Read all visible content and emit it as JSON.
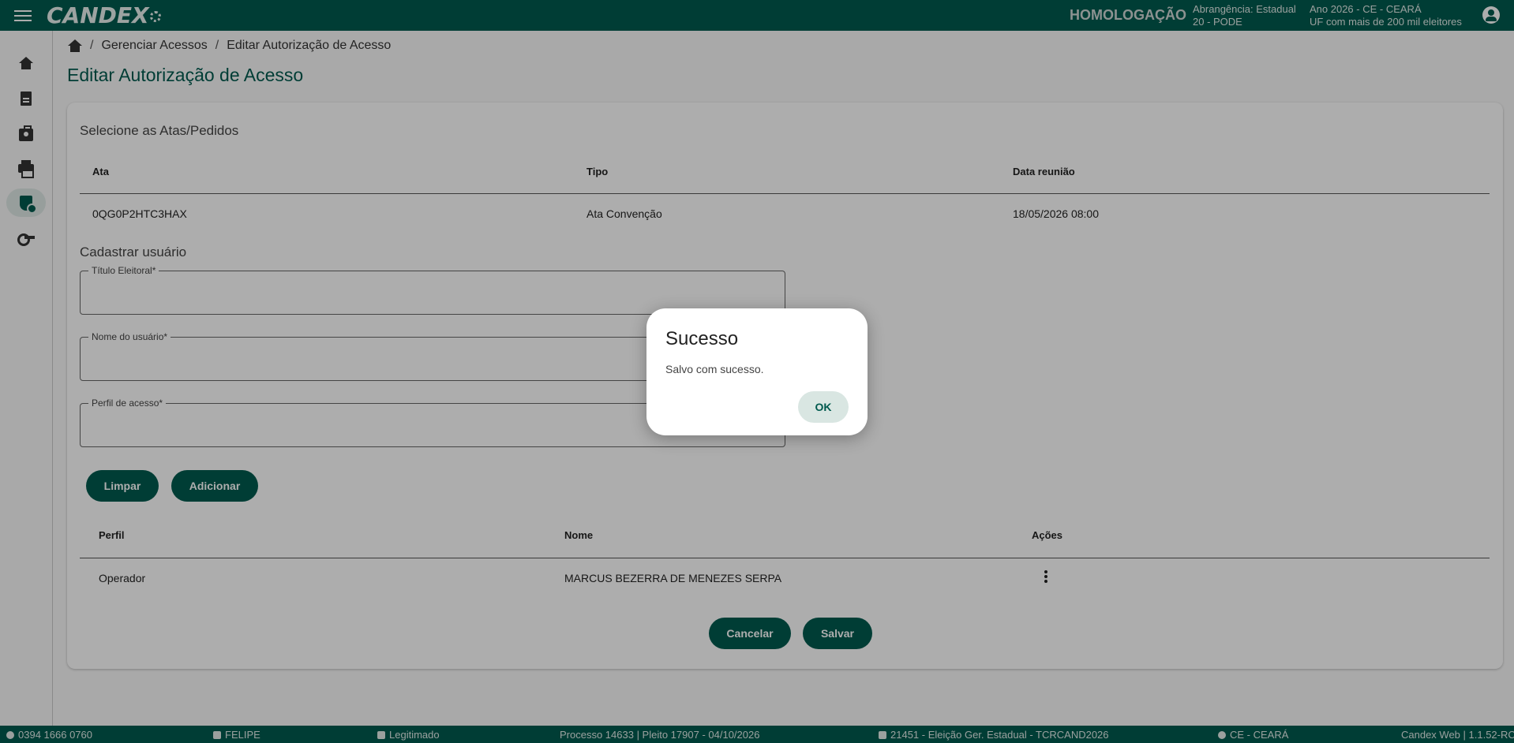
{
  "header": {
    "logo_text": "CANDEX",
    "environment": "HOMOLOGAÇÃO",
    "abrangencia_line1": "Abrangência: Estadual",
    "abrangencia_line2": "20 - PODE",
    "ano_line1": "Ano 2026 - CE - CEARÁ",
    "ano_line2": "UF com mais de 200 mil eleitores",
    "icons": [
      "menu-icon",
      "account-circle-icon"
    ]
  },
  "sidebar": {
    "items": [
      {
        "icon": "home-icon"
      },
      {
        "icon": "document-icon"
      },
      {
        "icon": "badge-icon"
      },
      {
        "icon": "print-icon"
      },
      {
        "icon": "shield-user-icon",
        "active": true
      },
      {
        "icon": "key-icon"
      }
    ]
  },
  "breadcrumb": {
    "items": [
      "Gerenciar Acessos",
      "Editar Autorização de Acesso"
    ],
    "separator": "/"
  },
  "page": {
    "title": "Editar Autorização de Acesso"
  },
  "atas": {
    "section_title": "Selecione as Atas/Pedidos",
    "columns": [
      "Ata",
      "Tipo",
      "Data reunião"
    ],
    "rows": [
      [
        "0QG0P2HTC3HAX",
        "Ata Convenção",
        "18/05/2026 08:00"
      ]
    ]
  },
  "form": {
    "section_title": "Cadastrar usuário",
    "fields": [
      {
        "label": "Título Eleitoral*",
        "value": ""
      },
      {
        "label": "Nome do usuário*",
        "value": ""
      },
      {
        "label": "Perfil de acesso*",
        "value": ""
      }
    ],
    "clear_label": "Limpar",
    "add_label": "Adicionar"
  },
  "users": {
    "columns": [
      "Perfil",
      "Nome",
      "Ações"
    ],
    "rows": [
      [
        "Operador",
        "MARCUS BEZERRA DE MENEZES SERPA"
      ]
    ]
  },
  "actions": {
    "cancel_label": "Cancelar",
    "save_label": "Salvar"
  },
  "statusbar": {
    "user_id": "0394 1666 0760",
    "user_name": "FELIPE",
    "status": "Legitimado",
    "processo": "Processo 14633 | Pleito 17907 - 04/10/2026",
    "eleicao": "21451 - Eleição Ger. Estadual - TCRCAND2026",
    "uf": "CE - CEARÁ",
    "version": "Candex Web | 1.1.52-RC"
  },
  "dialog": {
    "title": "Sucesso",
    "message": "Salvo com sucesso.",
    "ok_label": "OK"
  },
  "colors": {
    "primary": "#005a4e",
    "ok_button_bg": "#d9e6e2",
    "overlay": "rgba(0,0,0,0.32)"
  }
}
